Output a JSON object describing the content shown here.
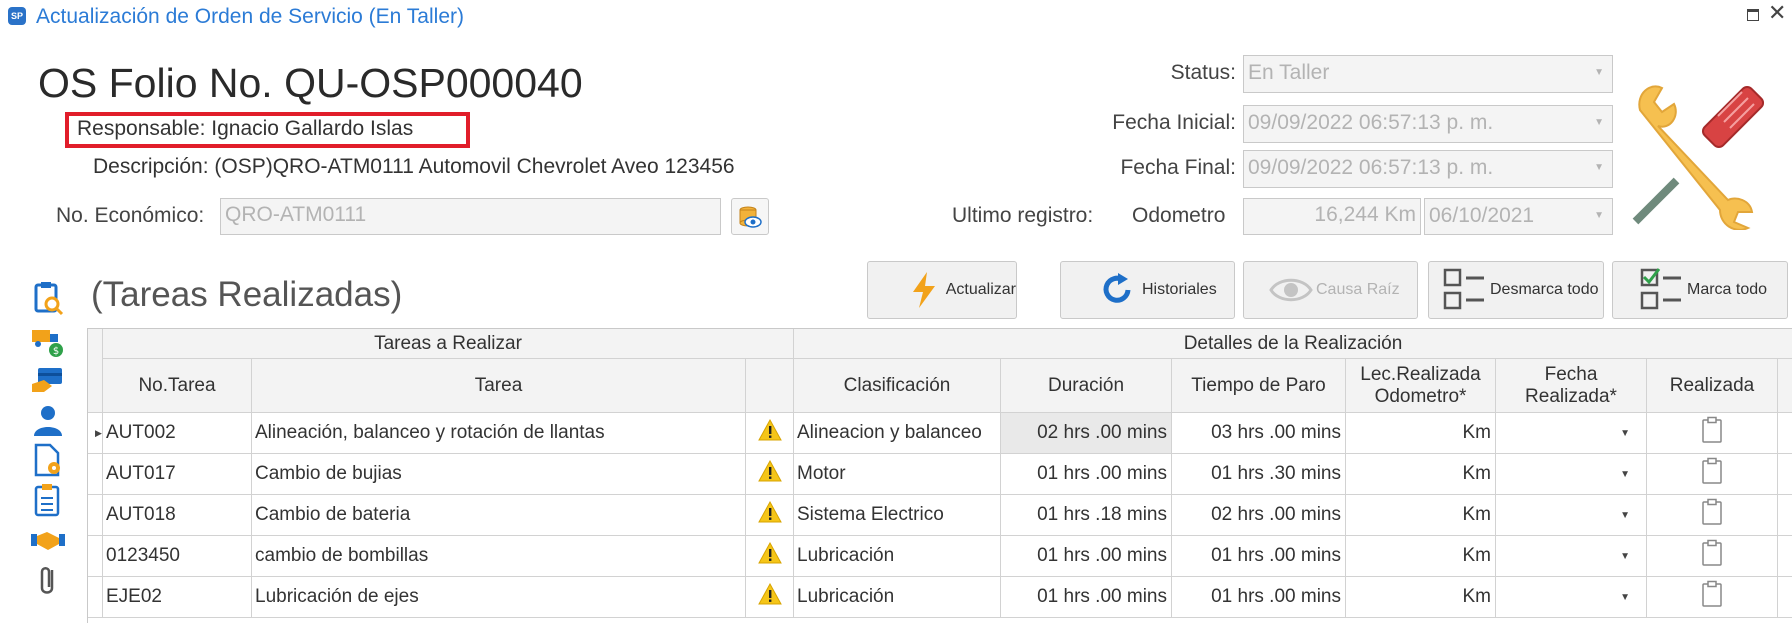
{
  "window": {
    "title": "Actualización de Orden de Servicio (En Taller)"
  },
  "header": {
    "folio": "OS Folio No. QU-OSP000040",
    "responsable": "Responsable: Ignacio Gallardo Islas",
    "descripcion": "Descripción: (OSP)QRO-ATM0111 Automovil  Chevrolet  Aveo  123456",
    "no_economico_label": "No. Económico:",
    "no_economico_value": "QRO-ATM0111"
  },
  "status_panel": {
    "status_label": "Status:",
    "status_value": "En Taller",
    "fecha_inicial_label": "Fecha Inicial:",
    "fecha_inicial_value": "09/09/2022 06:57:13 p. m.",
    "fecha_final_label": "Fecha Final:",
    "fecha_final_value": "09/09/2022 06:57:13 p. m.",
    "ultimo_registro_label": "Ultimo registro:",
    "odometro_label": "Odometro",
    "odometro_value": "16,244 Km",
    "odometro_fecha": "06/10/2021"
  },
  "section": {
    "title": "(Tareas Realizadas)"
  },
  "toolbar": {
    "actualizar": "Actualizar",
    "historiales": "Historiales",
    "causa_raiz": "Causa Raíz",
    "desmarca_todo": "Desmarca todo",
    "marca_todo": "Marca todo"
  },
  "grid": {
    "group_tareas": "Tareas a Realizar",
    "group_detalles": "Detalles de la Realización",
    "columns": {
      "no_tarea": "No.Tarea",
      "tarea": "Tarea",
      "clasificacion": "Clasificación",
      "duracion": "Duración",
      "tiempo_paro": "Tiempo de Paro",
      "lec_realizada_1": "Lec.Realizada",
      "lec_realizada_2": "Odometro*",
      "fecha_realizada_1": "Fecha",
      "fecha_realizada_2": "Realizada*",
      "realizada": "Realizada"
    },
    "rows": [
      {
        "no": "AUT002",
        "tarea": "Alineación, balanceo y rotación de llantas",
        "clasificacion": "Alineacion y balanceo",
        "duracion": "02 hrs .00 mins",
        "paro": "03 hrs .00 mins",
        "lec": "Km"
      },
      {
        "no": "AUT017",
        "tarea": "Cambio de bujias",
        "clasificacion": "Motor",
        "duracion": "01 hrs .00 mins",
        "paro": "01 hrs .30 mins",
        "lec": "Km"
      },
      {
        "no": "AUT018",
        "tarea": "Cambio de bateria",
        "clasificacion": "Sistema Electrico",
        "duracion": "01 hrs .18 mins",
        "paro": "02 hrs .00 mins",
        "lec": "Km"
      },
      {
        "no": "0123450",
        "tarea": "cambio de bombillas",
        "clasificacion": "Lubricación",
        "duracion": "01 hrs .00 mins",
        "paro": "01 hrs .00 mins",
        "lec": "Km"
      },
      {
        "no": "EJE02",
        "tarea": "Lubricación de ejes",
        "clasificacion": "Lubricación",
        "duracion": "01 hrs .00 mins",
        "paro": "01 hrs .00 mins",
        "lec": "Km"
      }
    ]
  },
  "sidebar": {
    "icons": [
      "clipboard-search-icon",
      "truck-money-icon",
      "handshake-card-icon",
      "user-icon",
      "document-settings-icon",
      "clipboard-list-icon",
      "handshake-icon",
      "paperclip-icon"
    ]
  },
  "colors": {
    "title": "#2b7bd6",
    "highlight_box": "#e11d2a",
    "sidebar_blue": "#1e6fc8",
    "sidebar_orange": "#f2a21a",
    "warning": "#f5c518"
  }
}
